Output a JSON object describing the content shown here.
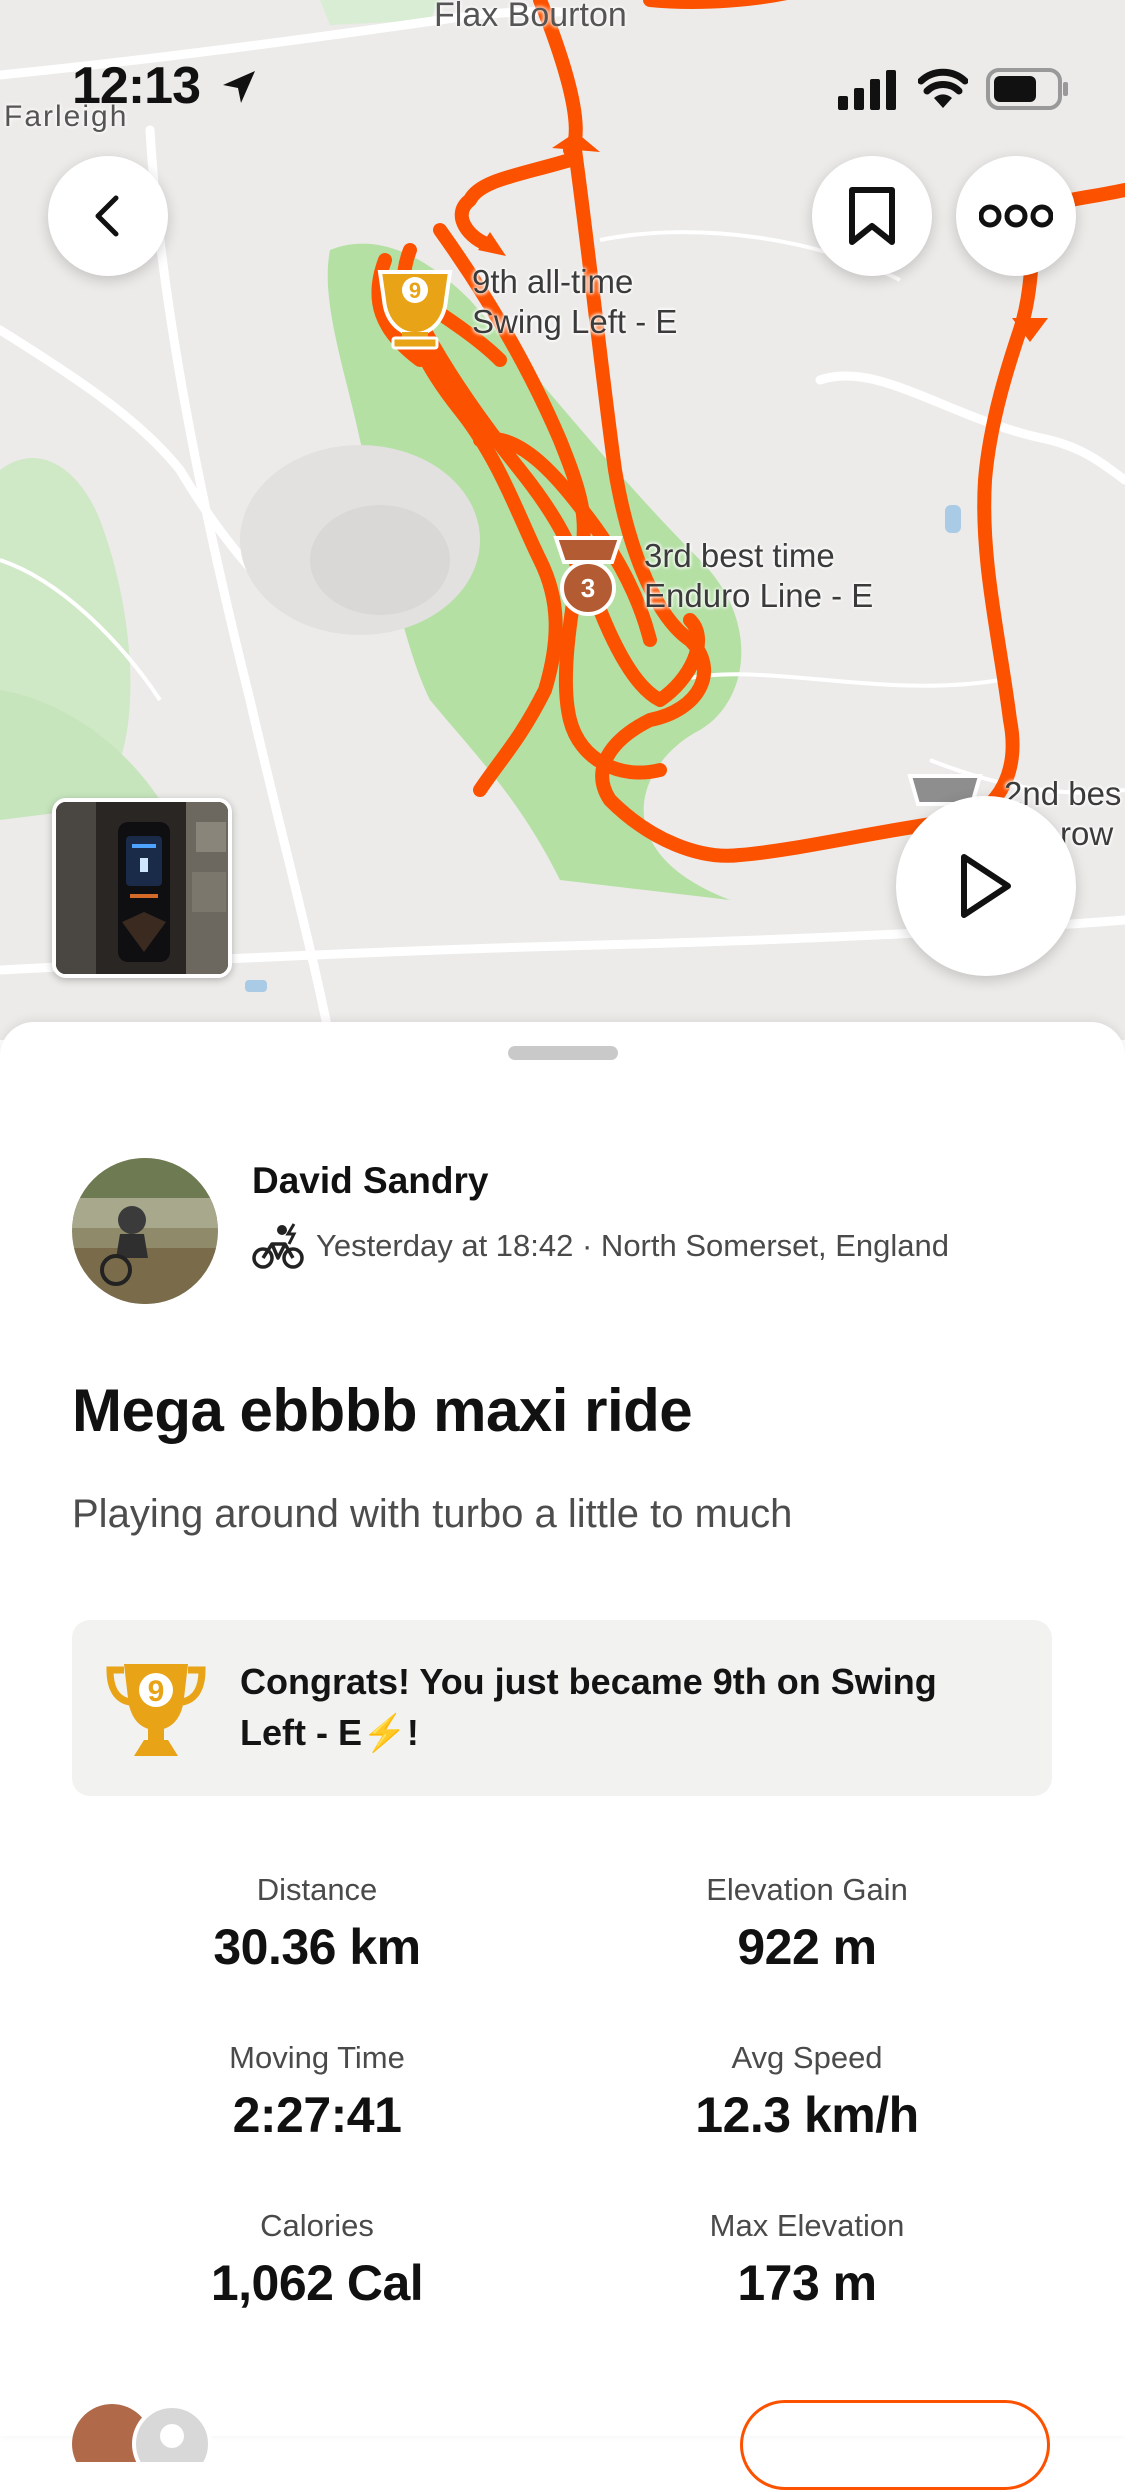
{
  "status_bar": {
    "time": "12:13"
  },
  "map": {
    "places": {
      "flax_bourton": "Flax Bourton",
      "farleigh": "Farleigh"
    },
    "achievements": [
      {
        "line1": "9th all-time",
        "line2": "Swing Left - E",
        "badge": "9"
      },
      {
        "line1": "3rd best time",
        "line2": "Enduro Line - E",
        "badge": "3"
      },
      {
        "line1": "2nd bes",
        "line2": "row"
      }
    ],
    "route_color": "#fc5200"
  },
  "toolbar": {
    "back_icon": "chevron-left-icon",
    "bookmark_icon": "bookmark-icon",
    "more_icon": "more-icon"
  },
  "activity": {
    "athlete_name": "David Sandry",
    "sport_icon": "ebike-icon",
    "meta": "Yesterday at 18:42 · North Somerset, England",
    "title": "Mega ebbbb maxi ride",
    "description": "Playing around with turbo a little to much",
    "achievement_banner": {
      "text": "Congrats! You just became 9th on Swing Left - E⚡!",
      "rank": "9"
    },
    "stats": [
      {
        "label": "Distance",
        "value": "30.36 km"
      },
      {
        "label": "Elevation Gain",
        "value": "922 m"
      },
      {
        "label": "Moving Time",
        "value": "2:27:41"
      },
      {
        "label": "Avg Speed",
        "value": "12.3 km/h"
      },
      {
        "label": "Calories",
        "value": "1,062 Cal"
      },
      {
        "label": "Max Elevation",
        "value": "173 m"
      }
    ]
  },
  "colors": {
    "accent": "#fc5200",
    "gold": "#e8a317",
    "bronze": "#b35c34"
  }
}
